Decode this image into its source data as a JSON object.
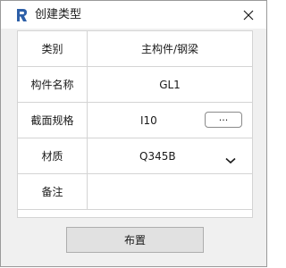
{
  "window": {
    "title": "创建类型",
    "app_icon": "revit-icon",
    "close_icon": "close-icon"
  },
  "form": {
    "rows": [
      {
        "label": "类别",
        "value": "主构件/钢梁"
      },
      {
        "label": "构件名称",
        "value": "GL1"
      },
      {
        "label": "截面规格",
        "value": "I10",
        "button_label": "..."
      },
      {
        "label": "材质",
        "value": "Q345B",
        "dropdown_icon": "chevron-down-icon"
      },
      {
        "label": "备注",
        "value": ""
      }
    ]
  },
  "actions": {
    "place_label": "布置"
  }
}
